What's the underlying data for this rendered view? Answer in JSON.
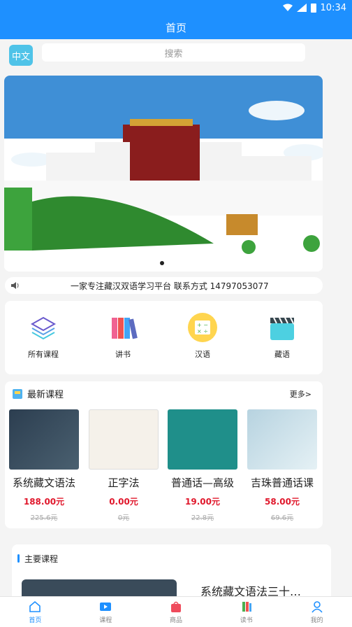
{
  "status": {
    "time": "10:34"
  },
  "header": {
    "title": "首页"
  },
  "search": {
    "lang_label": "中文",
    "placeholder": "搜索"
  },
  "notice": {
    "text": "一家专注藏汉双语学习平台 联系方式 14797053077"
  },
  "categories": [
    {
      "label": "所有课程",
      "icon": "layers-icon"
    },
    {
      "label": "讲书",
      "icon": "books-icon"
    },
    {
      "label": "汉语",
      "icon": "calculator-icon"
    },
    {
      "label": "藏语",
      "icon": "clapperboard-icon"
    }
  ],
  "latest": {
    "title": "最新课程",
    "more": "更多>",
    "courses": [
      {
        "name": "系统藏文语法",
        "price": "188.00元",
        "old_price": "225.6元"
      },
      {
        "name": "正字法",
        "price": "0.00元",
        "old_price": "0元"
      },
      {
        "name": "普通话—高级",
        "price": "19.00元",
        "old_price": "22.8元"
      },
      {
        "name": "吉珠普通话课",
        "price": "58.00元",
        "old_price": "69.6元"
      }
    ]
  },
  "main_courses": {
    "title": "主要课程",
    "first_name": "系统藏文语法三十…"
  },
  "tabs": [
    {
      "label": "首页",
      "icon": "home-icon",
      "active": true
    },
    {
      "label": "课程",
      "icon": "video-icon",
      "active": false
    },
    {
      "label": "商品",
      "icon": "bag-icon",
      "active": false
    },
    {
      "label": "读书",
      "icon": "book-icon",
      "active": false
    },
    {
      "label": "我的",
      "icon": "user-icon",
      "active": false
    }
  ],
  "colors": {
    "primary": "#1e90ff",
    "price": "#e0182c",
    "lang_button": "#4fc3e8"
  }
}
